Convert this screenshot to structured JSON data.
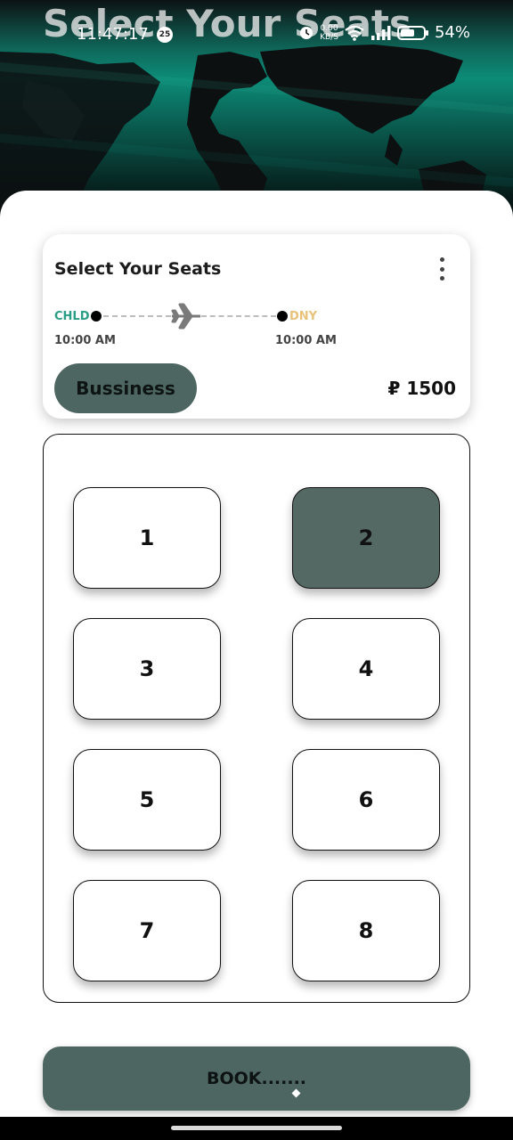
{
  "header": {
    "title": "Select Your Seats"
  },
  "status_bar": {
    "time": "11:47:17",
    "notification_count": "25",
    "network_speed_value": "0.00",
    "network_speed_unit": "KB/S",
    "battery_percent": "54%"
  },
  "flight_card": {
    "title": "Select Your Seats",
    "from_code": "CHLD",
    "to_code": "DNY",
    "from_time": "10:00 AM",
    "to_time": "10:00 AM",
    "class_label": "Bussiness",
    "price": "₽ 1500"
  },
  "seats": {
    "s1": "1",
    "s2": "2",
    "s3": "3",
    "s4": "4",
    "s5": "5",
    "s6": "6",
    "s7": "7",
    "s8": "8",
    "selected": "2"
  },
  "book_button": {
    "label": "BOOK......."
  },
  "colors": {
    "accent": "#4e6661",
    "from_code": "#2a9d86",
    "to_code": "#e8c27a"
  }
}
